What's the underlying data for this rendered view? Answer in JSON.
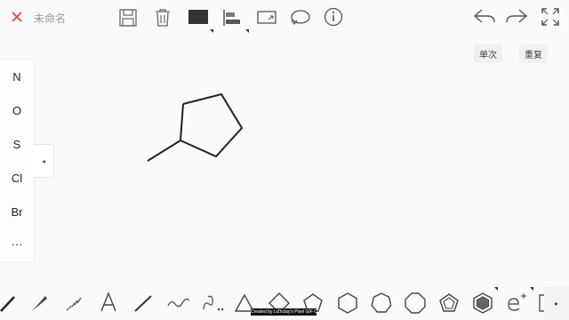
{
  "header": {
    "file_name": "未命名",
    "icons": [
      "close-icon",
      "save-icon",
      "delete-icon",
      "color-fill-icon",
      "align-icon",
      "resize-icon",
      "rotate-icon",
      "info-icon"
    ],
    "undo_icon": "undo-icon",
    "redo_icon": "redo-icon",
    "fullscreen_icon": "fullscreen-icon"
  },
  "modes": {
    "single": "单次",
    "repeat": "重复"
  },
  "elements": [
    "N",
    "O",
    "S",
    "Cl",
    "Br",
    "···"
  ],
  "bottom_tools": [
    "bond-single-tool",
    "bond-wedge-tool",
    "bond-hash-tool",
    "text-tool",
    "line-tool",
    "wavy-bond-tool",
    "curved-arrow-tool",
    "triangle-ring-tool",
    "square-ring-tool",
    "pentagon-ring-tool",
    "hexagon-ring-tool",
    "heptagon-ring-tool",
    "octagon-ring-tool",
    "pentagon-filled-tool",
    "benzene-tool",
    "electron-tool",
    "bracket-tool"
  ],
  "credit": "Created by LiZhiJay's Pixel GIF CX"
}
